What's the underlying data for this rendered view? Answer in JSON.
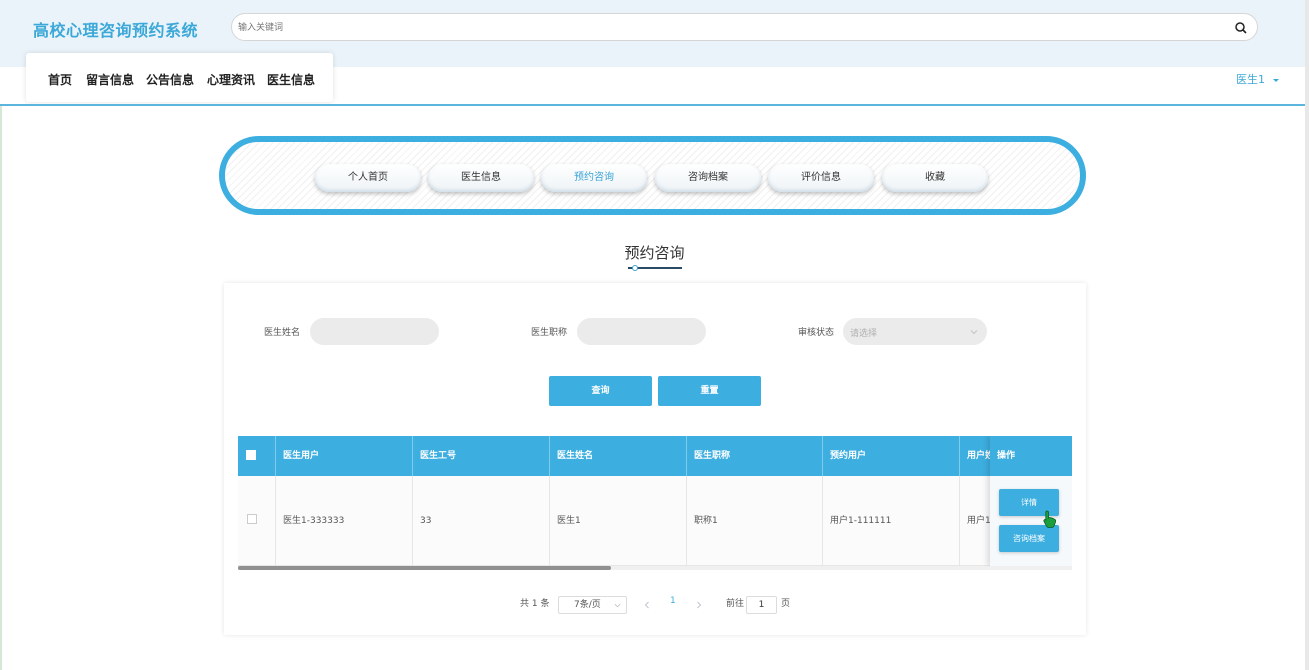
{
  "header": {
    "app_title": "高校心理咨询预约系统",
    "search_placeholder": "输入关键词",
    "search_icon": "search-icon"
  },
  "nav": {
    "items": [
      {
        "label": "首页"
      },
      {
        "label": "留言信息"
      },
      {
        "label": "公告信息"
      },
      {
        "label": "心理资讯"
      },
      {
        "label": "医生信息"
      }
    ],
    "user_label": "医生1",
    "user_icon": "caret-down-icon"
  },
  "tabs": [
    {
      "label": "个人首页"
    },
    {
      "label": "医生信息"
    },
    {
      "label": "预约咨询",
      "active": true
    },
    {
      "label": "咨询档案"
    },
    {
      "label": "评价信息"
    },
    {
      "label": "收藏"
    }
  ],
  "page_title": "预约咨询",
  "filters": {
    "doctor_name_label": "医生姓名",
    "doctor_name_value": "",
    "doctor_title_label": "医生职称",
    "doctor_title_value": "",
    "review_status_label": "审核状态",
    "review_status_placeholder": "请选择"
  },
  "buttons": {
    "query": "查询",
    "reset": "重置"
  },
  "table": {
    "columns": [
      "医生用户",
      "医生工号",
      "医生姓名",
      "医生职称",
      "预约用户",
      "用户姓",
      "操作"
    ],
    "rows": [
      {
        "doctor_user": "医生1-333333",
        "doctor_no": "33",
        "doctor_name": "医生1",
        "doctor_title": "职称1",
        "booking_user": "用户1-111111",
        "user_name": "用户1",
        "actions": [
          "详情",
          "咨询档案"
        ]
      }
    ]
  },
  "pagination": {
    "total": "共 1 条",
    "page_size": "7条/页",
    "current_page": "1",
    "goto_label": "前往",
    "goto_value": "1",
    "page_suffix": "页"
  },
  "colors": {
    "accent": "#3daee0",
    "brand_text": "#3ca8d8",
    "header_bg": "#eaf3fa"
  }
}
